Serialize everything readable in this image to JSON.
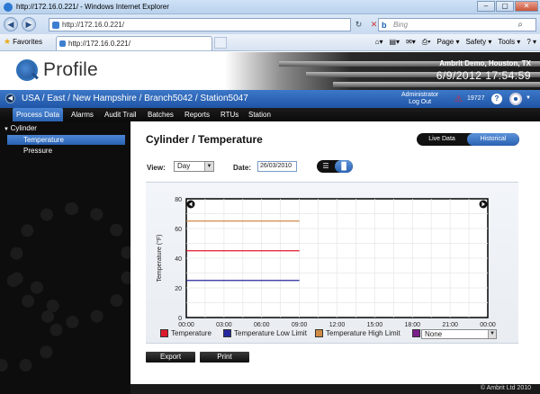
{
  "browser": {
    "window_title": "http://172.16.0.221/ - Windows Internet Explorer",
    "address": "http://172.16.0.221/",
    "search_placeholder": "Bing",
    "favorites_label": "Favorites",
    "tab_title": "http://172.16.0.221/",
    "commands": [
      "Page ▾",
      "Safety ▾",
      "Tools ▾",
      "? ▾"
    ]
  },
  "app": {
    "logo_text": "Profile",
    "company": "Ambrit Demo, Houston, TX",
    "datetime": "6/9/2012  17:54:59",
    "breadcrumb": "USA / East / New Hampshire / Branch5042 / Station5047",
    "user_role": "Administrator",
    "logout": "Log Out",
    "alarm_count": "19727",
    "help_label": "?",
    "menu": [
      "Process Data",
      "Alarms",
      "Audit Trail",
      "Batches",
      "Reports",
      "RTUs",
      "Station"
    ],
    "sidebar": {
      "group": "Cylinder",
      "items": [
        "Temperature",
        "Pressure"
      ]
    }
  },
  "main": {
    "title": "Cylinder / Temperature",
    "toggle_live": "Live Data",
    "toggle_historical": "Historical",
    "view_label": "View:",
    "view_value": "Day",
    "date_label": "Date:",
    "date_value": "26/03/2010",
    "legend_select": "None",
    "export_label": "Export",
    "print_label": "Print",
    "copyright": "© Ambrit Ltd 2010"
  },
  "colors": {
    "temperature": "#e0192d",
    "low_limit": "#26289e",
    "high_limit": "#d08a44",
    "none_swatch": "#7a1f8c"
  },
  "chart_data": {
    "type": "line",
    "xlabel": "",
    "ylabel": "Temperature (°F)",
    "x_ticks": [
      "00:00",
      "03:00",
      "06:00",
      "09:00",
      "12:00",
      "15:00",
      "18:00",
      "21:00",
      "00:00"
    ],
    "y_ticks": [
      0,
      20,
      40,
      60,
      80
    ],
    "ylim": [
      0,
      80
    ],
    "xlim_hours": [
      0,
      24
    ],
    "grid": true,
    "series": [
      {
        "name": "Temperature",
        "color": "#e0192d",
        "x": [
          0,
          9
        ],
        "y": [
          45,
          45
        ]
      },
      {
        "name": "Temperature Low Limit",
        "color": "#26289e",
        "x": [
          0,
          9
        ],
        "y": [
          25,
          25
        ]
      },
      {
        "name": "Temperature High Limit",
        "color": "#d08a44",
        "x": [
          0,
          9
        ],
        "y": [
          65,
          65
        ]
      }
    ]
  }
}
